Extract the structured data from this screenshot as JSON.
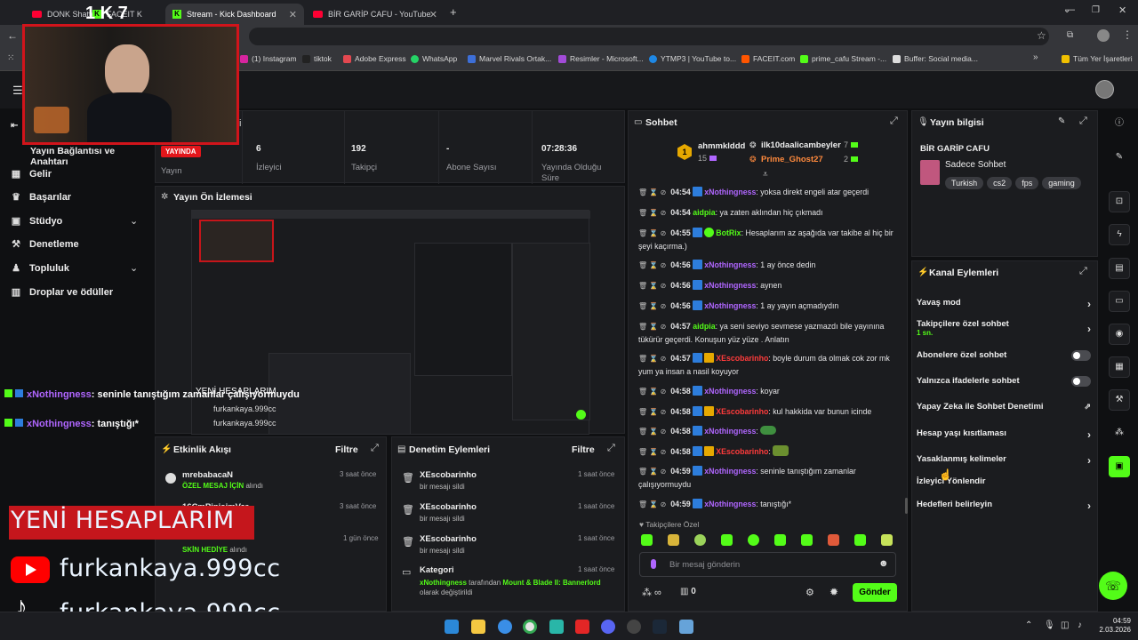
{
  "browser": {
    "tabs": [
      {
        "label": "DONK Shatters",
        "icon": "youtube-icon"
      },
      {
        "label": "FACEIT K",
        "icon": "kick-icon"
      },
      {
        "label": "Stream - Kick Dashboard",
        "icon": "kick-icon",
        "active": true
      },
      {
        "label": "BİR GARİP CAFU - YouTube",
        "icon": "youtube-icon"
      }
    ],
    "bookmarks": [
      "(1) Instagram",
      "tiktok",
      "Adobe Express",
      "WhatsApp",
      "Marvel Rivals Ortak...",
      "Resimler - Microsoft...",
      "YTMP3 | YouTube to...",
      "FACEIT.com",
      "prime_cafu Stream -...",
      "Buffer: Social media..."
    ],
    "all_bookmarks": "Tüm Yer İşaretleri"
  },
  "sidebar": {
    "partial_title": "Yayın Bağlantısı ve Anahtarı",
    "items": [
      {
        "label": "Gelir",
        "icon": "revenue-icon"
      },
      {
        "label": "Başarılar",
        "icon": "trophy-icon"
      },
      {
        "label": "Stüdyo",
        "icon": "studio-icon",
        "expandable": true
      },
      {
        "label": "Denetleme",
        "icon": "wrench-icon"
      },
      {
        "label": "Topluluk",
        "icon": "community-icon",
        "expandable": true
      },
      {
        "label": "Droplar ve ödüller",
        "icon": "gift-icon"
      }
    ]
  },
  "stats": {
    "live_badge": "YAYINDA",
    "stream_label": "Yayın",
    "items": [
      {
        "value": "6",
        "label": "İzleyici"
      },
      {
        "value": "192",
        "label": "Takipçi"
      },
      {
        "value": "-",
        "label": "Abone Sayısı"
      },
      {
        "value": "07:28:36",
        "label": "Yayında Olduğu Süre"
      }
    ]
  },
  "preview": {
    "title": "Yayın Ön İzlemesi"
  },
  "activity": {
    "title": "Etkinlik Akışı",
    "filter": "Filtre",
    "events": [
      {
        "name": "mrebabacaN",
        "highlight": "ÖZEL MESAJ İÇİN",
        "rest": "alındı",
        "time": "3 saat önce"
      },
      {
        "name": "16CmPipisimVar",
        "highlight": "",
        "rest": "",
        "time": "3 saat önce"
      },
      {
        "name": "",
        "highlight": "SKİN HEDİYE",
        "rest": "alındı",
        "time": "1 gün önce"
      }
    ]
  },
  "moderation": {
    "title": "Denetim Eylemleri",
    "filter": "Filtre",
    "actions": [
      {
        "name": "XEscobarinho",
        "sub": "bir mesajı sildi",
        "time": "1 saat önce"
      },
      {
        "name": "XEscobarinho",
        "sub": "bir mesajı sildi",
        "time": "1 saat önce"
      },
      {
        "name": "XEscobarinho",
        "sub": "bir mesajı sildi",
        "time": "1 saat önce"
      },
      {
        "name": "Kategori",
        "sub_user": "xNothingness",
        "sub_mid": "tarafından",
        "sub_game": "Mount & Blade II: Bannerlord",
        "sub_end": "olarak değiştirildi",
        "time": "1 saat önce"
      }
    ]
  },
  "chat": {
    "title": "Sohbet",
    "top_gifters": [
      {
        "name": "ahmmklddd",
        "count": "15",
        "rank": "1"
      },
      {
        "name": "ilk10daalicambeyler",
        "count": "7"
      },
      {
        "name": "Prime_Ghost27",
        "count": "2"
      }
    ],
    "messages": [
      {
        "time": "04:54",
        "user": "xNothingness",
        "color": "purple",
        "text": "yoksa direkt engeli atar geçerdi"
      },
      {
        "time": "04:54",
        "user": "aidpia",
        "color": "green",
        "text": "ya zaten aklından hiç çıkmadı"
      },
      {
        "time": "04:55",
        "user": "BotRix",
        "color": "green",
        "text": "Hesaplarım az aşağıda var takibe al hiç bir şeyi kaçırma.)"
      },
      {
        "time": "04:56",
        "user": "xNothingness",
        "color": "purple",
        "text": "1 ay önce dedin"
      },
      {
        "time": "04:56",
        "user": "xNothingness",
        "color": "purple",
        "text": "aynen"
      },
      {
        "time": "04:56",
        "user": "xNothingness",
        "color": "purple",
        "text": "1 ay yayın açmadıydın"
      },
      {
        "time": "04:57",
        "user": "aidpia",
        "color": "green",
        "text": "ya seni seviyo sevmese yazmazdı bile yayınına tükürür geçerdi. Konuşun yüz yüze . Anlatın"
      },
      {
        "time": "04:57",
        "user": "XEscobarinho",
        "color": "red",
        "text": "boyle durum da olmak cok zor mk yum ya insan a nasil koyuyor"
      },
      {
        "time": "04:58",
        "user": "xNothingness",
        "color": "purple",
        "text": "koyar"
      },
      {
        "time": "04:58",
        "user": "XEscobarinho",
        "color": "red",
        "text": "kul hakkida var bunun icinde"
      },
      {
        "time": "04:58",
        "user": "xNothingness",
        "color": "purple",
        "text": ""
      },
      {
        "time": "04:58",
        "user": "XEscobarinho",
        "color": "red",
        "text": ""
      },
      {
        "time": "04:59",
        "user": "xNothingness",
        "color": "purple",
        "text": "seninle tanıştığım zamanlar çalışıyormuydu"
      },
      {
        "time": "04:59",
        "user": "xNothingness",
        "color": "purple",
        "text": "tanıştığı*"
      }
    ],
    "followers_only": "Takipçilere Özel",
    "input_placeholder": "Bir mesaj gönderin",
    "infinity_count": "",
    "gift_count": "0",
    "send_label": "Gönder"
  },
  "stream_info": {
    "title": "Yayın bilgisi",
    "channel": "BİR GARİP CAFU",
    "category": "Sadece Sohbet",
    "tags": [
      "Turkish",
      "cs2",
      "fps",
      "gaming"
    ]
  },
  "channel_actions": {
    "title": "Kanal Eylemleri",
    "rows": [
      {
        "label": "Yavaş mod",
        "control": "chevron"
      },
      {
        "label": "Takipçilere özel sohbet",
        "sub": "1 sn.",
        "control": "chevron"
      },
      {
        "label": "Abonelere özel sohbet",
        "control": "toggle"
      },
      {
        "label": "Yalnızca ifadelerle sohbet",
        "control": "toggle"
      },
      {
        "label": "Yapay Zeka ile Sohbet Denetimi",
        "control": "external"
      },
      {
        "label": "Hesap yaşı kısıtlaması",
        "control": "chevron"
      },
      {
        "label": "Yasaklanmış kelimeler",
        "control": "chevron"
      },
      {
        "label": "İzleyici Yönlendir",
        "control": "none"
      },
      {
        "label": "Hedefleri belirleyin",
        "control": "chevron"
      }
    ]
  },
  "overlay": {
    "chat_lines": [
      {
        "user": "xNothingness",
        "text": ": seninle tanıştığım zamanlar çalışıyormuydu"
      },
      {
        "user": "xNothingness",
        "text": ": tanıştığı*"
      }
    ],
    "new_accounts": "YENİ HESAPLARIM",
    "youtube_handle": "furkankaya.999cc",
    "tiktok_handle": "furkankaya.999cc",
    "webcam_top_digits": "1 K 7"
  },
  "taskbar": {
    "time": "04:59",
    "date": "2.03.2026"
  },
  "colors": {
    "kick_green": "#53fc18",
    "panel_bg": "#1b1c1f",
    "page_bg": "#0f1012",
    "live_red": "#e3161b"
  }
}
